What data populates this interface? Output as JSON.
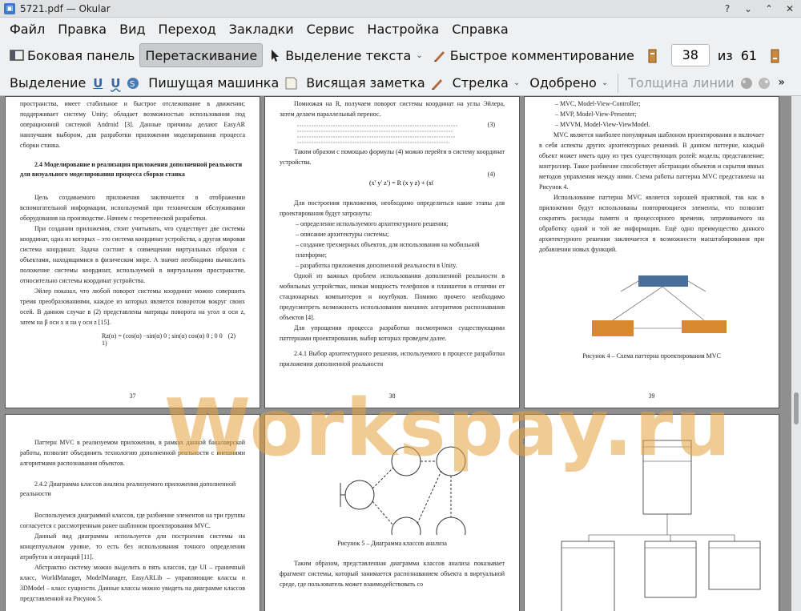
{
  "window": {
    "title": "5721.pdf  — Okular"
  },
  "menu": [
    "Файл",
    "Правка",
    "Вид",
    "Переход",
    "Закладки",
    "Сервис",
    "Настройка",
    "Справка"
  ],
  "toolbar": {
    "sidebar": "Боковая панель",
    "drag": "Перетаскивание",
    "text_select": "Выделение текста",
    "quick_comment": "Быстрое комментирование",
    "page_current": "38",
    "page_of": "из",
    "page_total": "61"
  },
  "annot_toolbar": {
    "selection": "Выделение",
    "typewriter": "Пишущая машинка",
    "hanging_note": "Висящая заметка",
    "arrow": "Стрелка",
    "approved": "Одобрено",
    "line_width": "Толщина линии"
  },
  "watermark": "Workspay.ru",
  "pages": {
    "p37": {
      "num": "37",
      "top_lines": "пространства, имеет стабильное и быстрое отслеживание в движении; поддерживает систему Unity; обладает возможностью использования под операционной системой Android [3]. Данные причины делают EasyAR наилучшим выбором, для разработки приложения моделирования процесса сборки станка.",
      "heading": "2.4 Моделирование и реализация приложения дополненной реальности для визуального моделирования процесса сборки станка",
      "p1": "Цель создаваемого приложения заключается в отображении вспомогательной информации, используемой при техническом обслуживании оборудования на производстве. Начнем с теоретической разработки.",
      "p2": "При создании приложения, стоит учитывать, что существует две системы координат, одна из которых – это система координат устройства, а другая мировая система координат. Задача состоит в совмещении виртуальных образов с объектами, находящимися в физическом мире. А значит необходимо вычислить положение системы координат, используемой в виртуальном пространстве, относительно системы координат устройства.",
      "p3": "Эйлер показал, что любой поворот системы координат можно совершить тремя преобразованиями, каждое из которых является поворотом вокруг своих осей. В данном случае в (2) представлены матрицы поворота на угол α оси z, затем на β оси x и на γ оси z [15].",
      "formula": "Rz(α) = (cos(α)  −sin(α)  0 ; sin(α)  cos(α)  0 ; 0  0  1)",
      "formula_no": "(2)"
    },
    "p38": {
      "num": "38",
      "p1": "Помножая на R, получаем поворот системы координат на углы Эйлера, затем делаем параллельный перенос.",
      "formula3_no": "(3)",
      "p2": "Таким образом с помощью формулы (4) можно перейти в систему координат устройства.",
      "formula4_no": "(4)",
      "p3": "Для построения приложения, необходимо определиться какие этапы для проектирования будут затронуты:",
      "li1": "–   определение используемого архитектурного решения;",
      "li2": "–   описание архитектуры системы;",
      "li3": "–   создание трехмерных объектов, для использования на мобильной платформе;",
      "li4": "–   разработка приложения дополненной реальности в Unity.",
      "p4": "Одной из важных проблем использования дополненной реальности в мобильных устройствах, низкая мощность телефонов и планшетов в отличии от стационарных компьютеров и ноутбуков. Помимо прочего необходимо предусмотреть возможность использования внешних алгоритмов распознавания объектов [4].",
      "p5": "Для упрощения процесса разработки посмотримся существующими паттернами проектирования, выбор которых проведем далее.",
      "p6": "2.4.1 Выбор архитектурного решения, используемого в процессе разработки приложения дополненной реальности"
    },
    "p39": {
      "num": "39",
      "li1": "–   MVC, Model-View-Controller;",
      "li2": "–   MVP, Model-View-Presenter;",
      "li3": "–   MVVM, Model-View-ViewModel.",
      "p1": "MVC является наиболее популярным шаблоном проектирования и включает в себя аспекты других архитектурных решений. В данном паттерне, каждый объект может иметь одну из трех существующих ролей: модель; представление; контроллер. Такое разбиение способствует абстракции объектов и скрытия явных методов управления между ними. Схема работы паттерна MVC представлена на Рисунок 4.",
      "p2": "Использование паттерна MVC является хорошей практикой, так как в приложении будут использованы повторяющиеся элементы, что позволит сократить расходы памяти и процессорного времени, затрачиваемого на обработку одной и той же информации. Ещё одно преимущество данного архитектурного решения заключается в возможности масштабирования при добавлении новых функций.",
      "caption": "Рисунок 4 – Схема паттерна проектирования MVC"
    },
    "p40": {
      "p1": "Паттерн MVC в реализуемом приложении, в рамках данной бакалаврской работы, позволит объединить технологию дополненной реальности с внешними алгоритмами распознавания объектов.",
      "heading": "2.4.2 Диаграмма классов анализа реализуемого приложения дополненной реальности",
      "p2": "Воспользуемся диаграммой классов, где разбиение элементов на три группы согласуется с рассмотренным ранее шаблоном проектирования MVC.",
      "p3": "Данный вид диаграммы используется для построения системы на концептуальном уровне, то есть без использования точного определения атрибутов и операций [11].",
      "p4": "Абстрактно систему можно выделить в пять классов, где UI – граничный класс, WorldManager, ModelManager, EasyARLib – управляющие классы и 3DModel – класс сущности. Данные классы можно увидеть на диаграмме классов представленной на Рисунок 5."
    },
    "p41": {
      "caption": "Рисунок 5 – Диаграмма классов анализа",
      "p1": "Таким образом, представленная диаграмма классов анализа показывает фрагмент системы, который занимается распознаванием объекта в виртуальной среде, где пользователь может взаимодействовать со"
    }
  }
}
